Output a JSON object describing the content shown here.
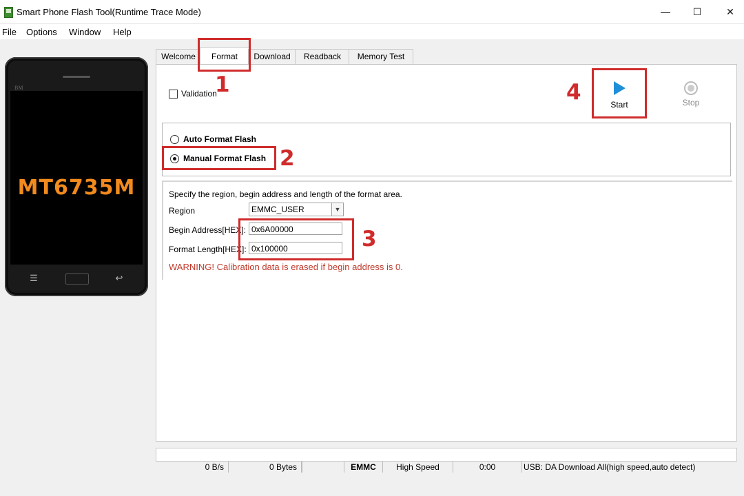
{
  "window": {
    "title": "Smart Phone Flash Tool(Runtime Trace Mode)",
    "minimize": "—",
    "maximize": "☐",
    "close": "✕"
  },
  "menu": {
    "items": [
      "File",
      "Options",
      "Window",
      "Help"
    ]
  },
  "phone": {
    "model": "MT6735M",
    "brand": "BM",
    "keys": {
      "menu": "☰",
      "home": "▭",
      "back": "↩"
    }
  },
  "tabs": [
    "Welcome",
    "Format",
    "Download",
    "Readback",
    "Memory Test"
  ],
  "active_tab": "Format",
  "format": {
    "validation_label": "Validation",
    "validation_checked": false,
    "start_label": "Start",
    "stop_label": "Stop",
    "radio_auto": "Auto Format Flash",
    "radio_manual": "Manual Format Flash",
    "selected_mode": "Manual Format Flash",
    "description": "Specify the region, begin address and length of the format area.",
    "region_label": "Region",
    "region_value": "EMMC_USER",
    "begin_label": "Begin Address[HEX]:",
    "begin_value": "0x6A00000",
    "length_label": "Format Length[HEX]:",
    "length_value": "0x100000",
    "warning": "WARNING! Calibration data is erased if begin address is 0."
  },
  "annotations": {
    "a1": "1",
    "a2": "2",
    "a3": "3",
    "a4": "4",
    "color": "#d02b2b"
  },
  "status": {
    "speed": "0 B/s",
    "bytes": "0 Bytes",
    "storage": "EMMC",
    "mode": "High Speed",
    "time": "0:00",
    "usb": "USB: DA Download All(high speed,auto detect)"
  },
  "colors": {
    "accent": "#1e8fd9",
    "model": "#f28a1e",
    "warning": "#c0392b"
  }
}
